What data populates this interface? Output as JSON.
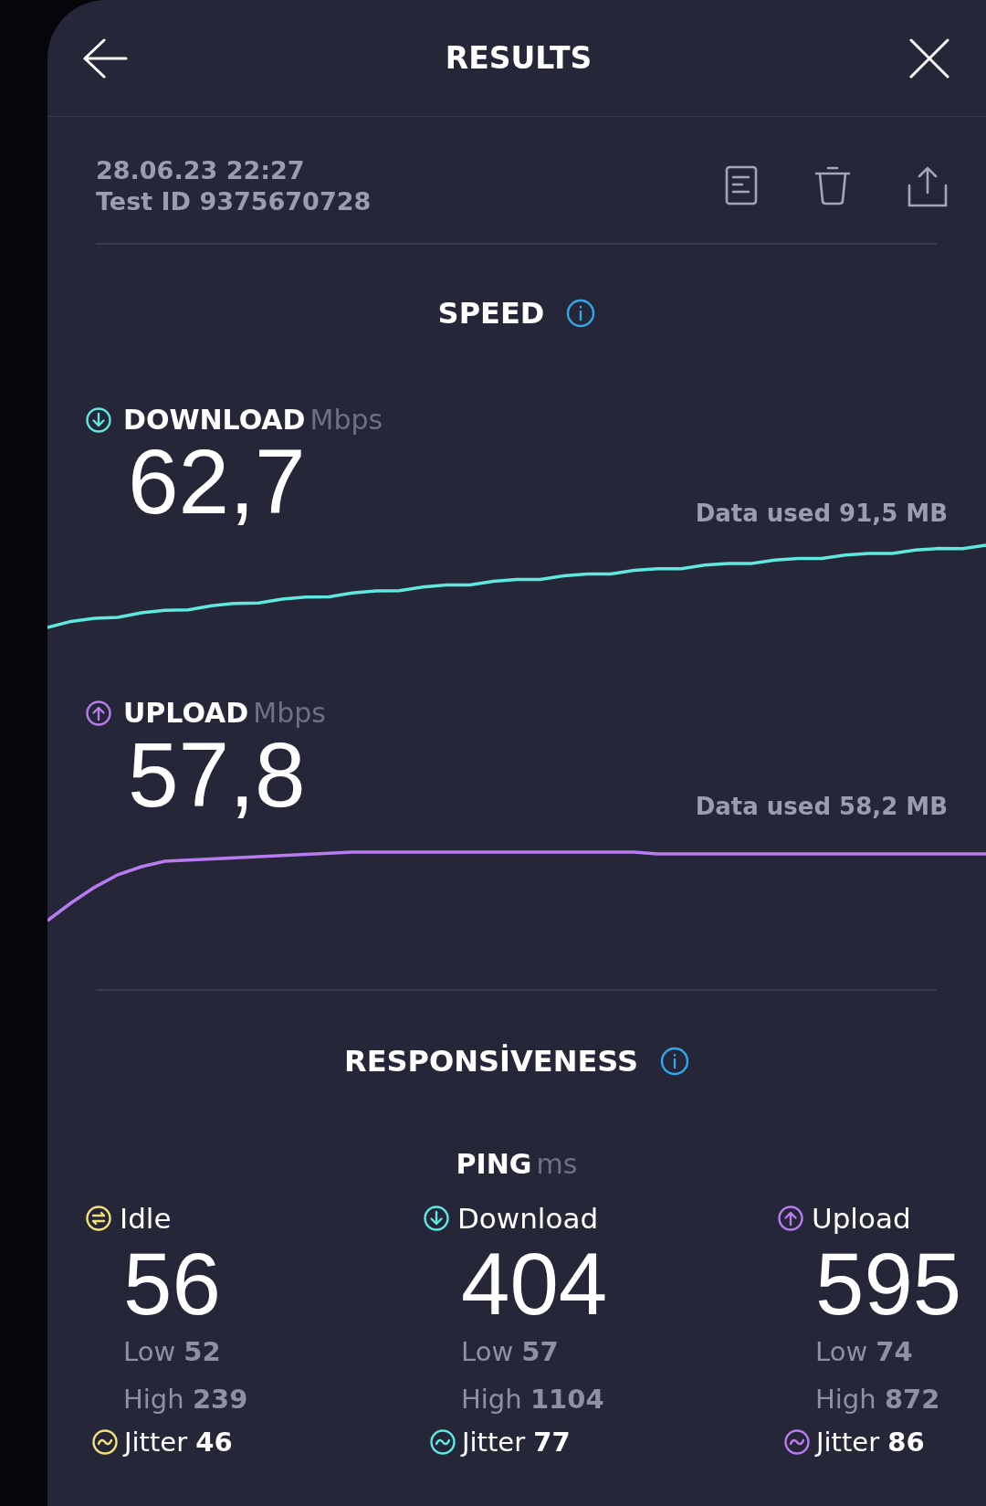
{
  "header": {
    "title": "RESULTS"
  },
  "test": {
    "date": "28.06.23 22:27",
    "test_id": "Test ID 9375670728"
  },
  "speed": {
    "title": "SPEED",
    "metrics": [
      {
        "kind": "download",
        "label": "DOWNLOAD",
        "unit": "Mbps",
        "value": "62,7",
        "data_used": "Data used 91,5 MB",
        "color": "#5ee8e0"
      },
      {
        "kind": "upload",
        "label": "UPLOAD",
        "unit": "Mbps",
        "value": "57,8",
        "data_used": "Data used 58,2 MB",
        "color": "#b97cf0"
      }
    ]
  },
  "responsiveness": {
    "title": "RESPONSİVENESS",
    "ping_label": "PING",
    "ping_unit": "ms",
    "columns": [
      {
        "kind": "idle",
        "label": "Idle",
        "value": "56",
        "low_label": "Low",
        "low": "52",
        "high_label": "High",
        "high": "239",
        "jitter_label": "Jitter",
        "jitter": "46",
        "color": "#f3e27c"
      },
      {
        "kind": "download",
        "label": "Download",
        "value": "404",
        "low_label": "Low",
        "low": "57",
        "high_label": "High",
        "high": "1104",
        "jitter_label": "Jitter",
        "jitter": "77",
        "color": "#5ee8e0"
      },
      {
        "kind": "upload",
        "label": "Upload",
        "value": "595",
        "low_label": "Low",
        "low": "74",
        "high_label": "High",
        "high": "872",
        "jitter_label": "Jitter",
        "jitter": "86",
        "color": "#b97cf0"
      }
    ]
  }
}
